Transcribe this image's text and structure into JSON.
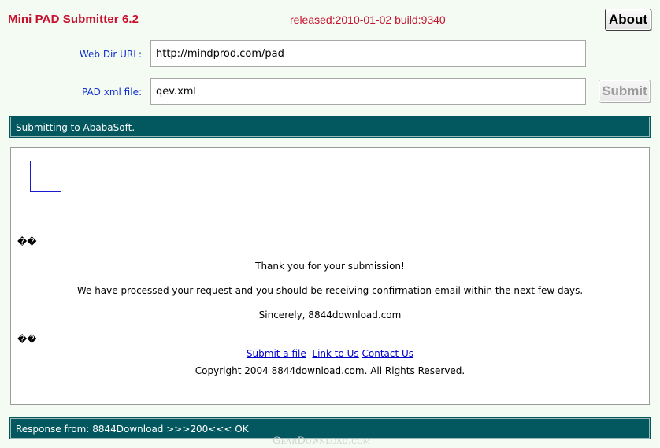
{
  "app": {
    "title": "Mini PAD Submitter 6.2",
    "release_info": "released:2010-01-02 build:9340",
    "about_label": "About",
    "submit_label": "Submit"
  },
  "form": {
    "web_dir_url_label": "Web Dir URL:",
    "web_dir_url_value": "http://mindprod.com/pad",
    "pad_xml_label": "PAD xml file:",
    "pad_xml_value": "qev.xml"
  },
  "status": {
    "text": "Submitting to AbabaSoft."
  },
  "response_page": {
    "garbled_1": "��",
    "thanks": "Thank you for your submission!",
    "processed": "We have processed your request and you should be receiving confirmation email within the next few days.",
    "sincerely": "Sincerely, 8844download.com",
    "garbled_2": "��",
    "links": [
      "Submit a file",
      "Link to Us",
      "Contact Us"
    ],
    "copyright": "Copyright 2004 8844download.com. All Rights Reserved."
  },
  "response": {
    "text": "Response from: 8844Download >>>200<<< OK"
  },
  "watermark": "GearDownload.com",
  "colors": {
    "background": "#f3fbf2",
    "title_red": "#c8102e",
    "bar_teal": "#03585f",
    "label_blue": "#1030d0",
    "link_blue": "#0000cc"
  }
}
